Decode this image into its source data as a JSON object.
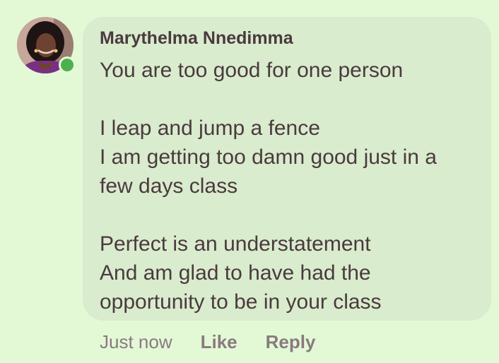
{
  "comment": {
    "author_name": "Marythelma Nnedimma",
    "message_lines": [
      "You are too good for one person",
      "",
      "I leap and jump a fence",
      "I am getting too damn good just in a",
      "few days class",
      "",
      "Perfect is an understatement",
      "And am glad to have had the",
      "opportunity to be in your class"
    ],
    "timestamp": "Just now",
    "like_label": "Like",
    "reply_label": "Reply",
    "author_online": true
  },
  "colors": {
    "background": "#e3f9d6",
    "bubble": "#d9eccd",
    "text": "#4a3a3f",
    "action_text": "#8a7a80",
    "online_indicator": "#4caf50"
  }
}
